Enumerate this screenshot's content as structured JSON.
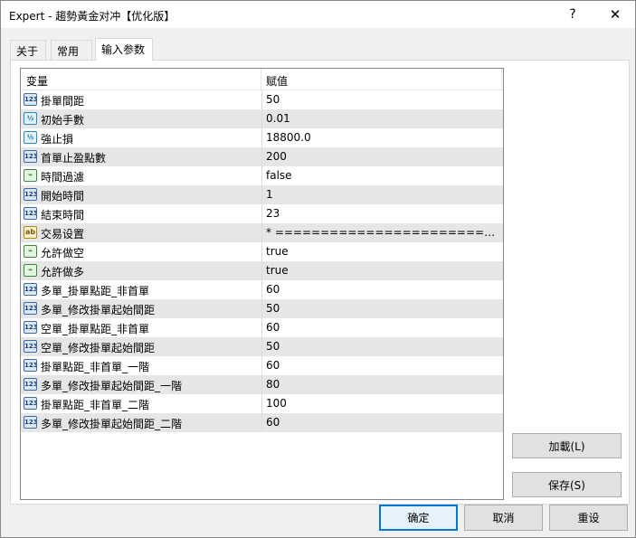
{
  "window": {
    "title": "Expert - 趨勢黃金对冲【优化版】",
    "help_glyph": "?",
    "close_glyph": "✕"
  },
  "tabs": [
    {
      "label": "关于",
      "active": false
    },
    {
      "label": "常用",
      "active": false
    },
    {
      "label": "输入参数",
      "active": true
    }
  ],
  "grid": {
    "columns": [
      "变量",
      "赋值"
    ],
    "rows": [
      {
        "icon": "123",
        "type": "int",
        "name": "掛單間距",
        "value": "50"
      },
      {
        "icon": "½",
        "type": "double",
        "name": "初始手數",
        "value": "0.01"
      },
      {
        "icon": "½",
        "type": "double",
        "name": "強止損",
        "value": "18800.0"
      },
      {
        "icon": "123",
        "type": "int",
        "name": "首單止盈點數",
        "value": "200"
      },
      {
        "icon": "⌁",
        "type": "bool",
        "name": "時間過濾",
        "value": "false"
      },
      {
        "icon": "123",
        "type": "int",
        "name": "開始時間",
        "value": "1"
      },
      {
        "icon": "123",
        "type": "int",
        "name": "結束時間",
        "value": "23"
      },
      {
        "icon": "ab",
        "type": "string",
        "name": "交易设置",
        "value": "* ===========================..."
      },
      {
        "icon": "⌁",
        "type": "bool",
        "name": "允許做空",
        "value": "true"
      },
      {
        "icon": "⌁",
        "type": "bool",
        "name": "允許做多",
        "value": "true"
      },
      {
        "icon": "123",
        "type": "int",
        "name": "多單_掛單點距_非首單",
        "value": "60"
      },
      {
        "icon": "123",
        "type": "int",
        "name": "多單_修改掛單起始間距",
        "value": "50"
      },
      {
        "icon": "123",
        "type": "int",
        "name": "空單_掛單點距_非首單",
        "value": "60"
      },
      {
        "icon": "123",
        "type": "int",
        "name": "空單_修改掛單起始間距",
        "value": "50"
      },
      {
        "icon": "123",
        "type": "int",
        "name": "掛單點距_非首單_一階",
        "value": "60"
      },
      {
        "icon": "123",
        "type": "int",
        "name": "多單_修改掛單起始間距_一階",
        "value": "80"
      },
      {
        "icon": "123",
        "type": "int",
        "name": "掛單點距_非首單_二階",
        "value": "100"
      },
      {
        "icon": "123",
        "type": "int",
        "name": "多單_修改掛單起始間距_二階",
        "value": "60"
      }
    ]
  },
  "buttons": {
    "load": "加載(L)",
    "save": "保存(S)",
    "ok": "确定",
    "cancel": "取消",
    "reset": "重设"
  }
}
